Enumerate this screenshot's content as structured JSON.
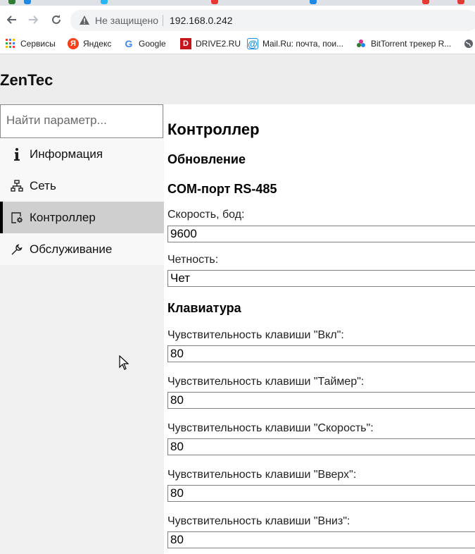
{
  "browser": {
    "security_label": "Не защищено",
    "url": "192.168.0.242",
    "bookmarks": [
      {
        "label": "Сервисы",
        "icon": "apps-grid-icon",
        "color": "#4285f4"
      },
      {
        "label": "Яндекс",
        "icon": "yandex-icon",
        "color": "#fc3f1d"
      },
      {
        "label": "Google",
        "icon": "google-icon",
        "color": "#4285f4"
      },
      {
        "label": "DRIVE2.RU",
        "icon": "drive2-icon",
        "color": "#c4161c"
      },
      {
        "label": "Mail.Ru: почта, пои...",
        "icon": "mailru-icon",
        "color": "#168de2"
      },
      {
        "label": "BitTorrent трекер R...",
        "icon": "rutracker-icon",
        "color": "#d6318d"
      }
    ]
  },
  "app": {
    "title": "ZenTec"
  },
  "sidebar": {
    "search_placeholder": "Найти параметр...",
    "items": [
      {
        "label": "Информация",
        "icon": "info-icon",
        "active": false
      },
      {
        "label": "Сеть",
        "icon": "network-icon",
        "active": false
      },
      {
        "label": "Контроллер",
        "icon": "controller-settings-icon",
        "active": true
      },
      {
        "label": "Обслуживание",
        "icon": "wrench-icon",
        "active": false
      }
    ]
  },
  "main": {
    "title": "Контроллер",
    "section_update": "Обновление",
    "section_com": "COM-порт RS-485",
    "speed_label": "Скорость, бод:",
    "speed_value": "9600",
    "parity_label": "Четность:",
    "parity_value": "Чет",
    "section_keyboard": "Клавиатура",
    "keys": [
      {
        "label": "Чувствительность клавиши \"Вкл\":",
        "value": "80"
      },
      {
        "label": "Чувствительность клавиши \"Таймер\":",
        "value": "80"
      },
      {
        "label": "Чувствительность клавиши \"Скорость\":",
        "value": "80"
      },
      {
        "label": "Чувствительность клавиши \"Вверх\":",
        "value": "80"
      },
      {
        "label": "Чувствительность клавиши \"Вниз\":",
        "value": "80"
      }
    ]
  }
}
